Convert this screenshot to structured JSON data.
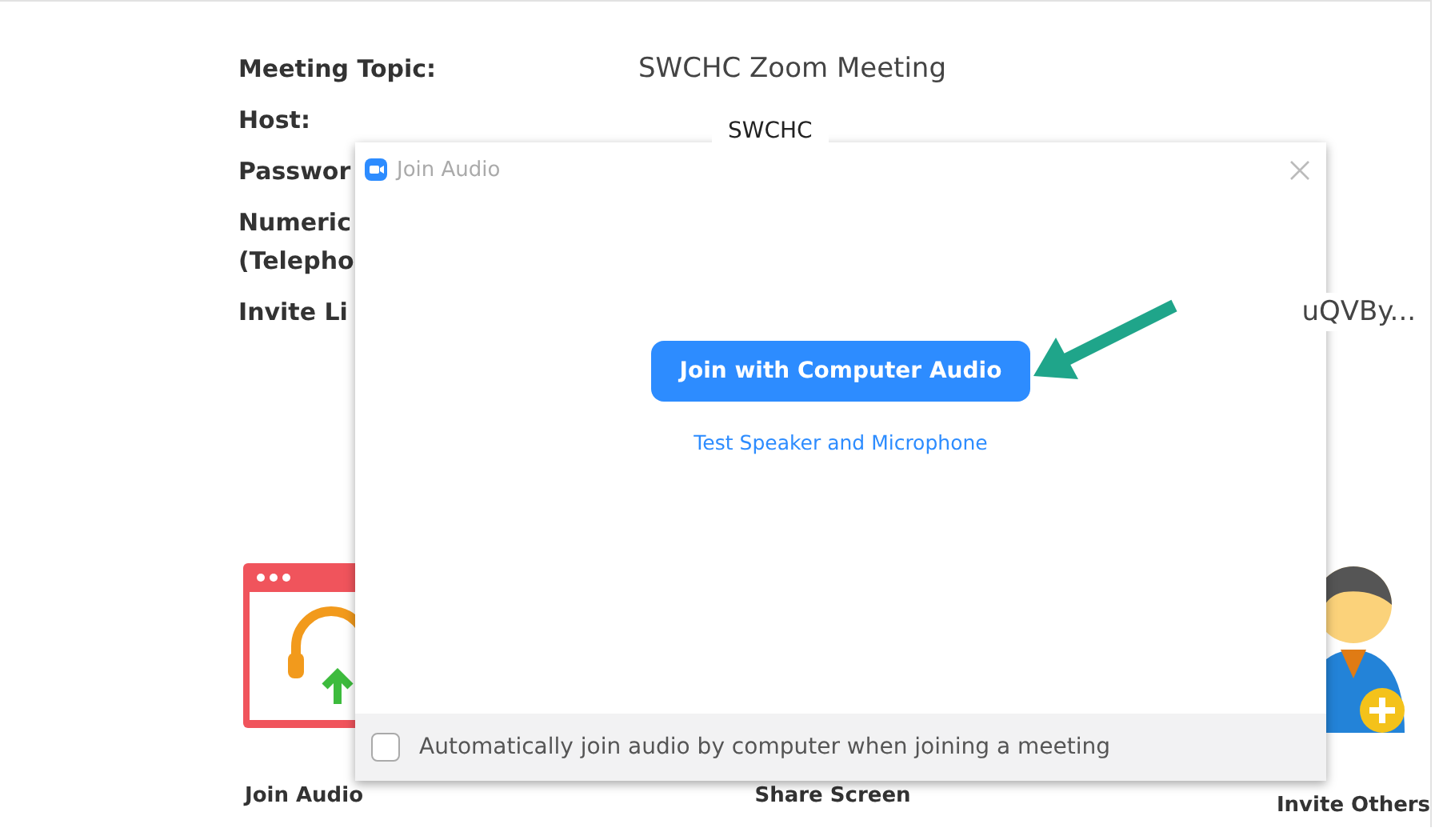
{
  "meeting_info": [
    {
      "kind": "field",
      "label": [
        "Meeting Topic:"
      ],
      "value": "SWCHC Zoom Meeting"
    },
    {
      "label": [
        "Host:"
      ],
      "value": "SWCHC"
    },
    {
      "label": [
        "Passwor"
      ]
    },
    {
      "label": [
        "Numeric",
        "(Telepho"
      ]
    },
    {
      "kind": "link",
      "label": [
        "Invite Li"
      ],
      "value": "uQVBy..."
    }
  ],
  "actions": [
    {
      "kind": "headphones",
      "label": "Join Audio"
    },
    {
      "kind": "share",
      "label": "Share Screen"
    },
    {
      "kind": "invite",
      "label": "Invite Others"
    }
  ],
  "dialog": {
    "title": "Join Audio",
    "primary_button": "Join with Computer Audio",
    "link": "Test Speaker and Microphone",
    "auto_join": {
      "label": "Automatically join audio by computer when joining a meeting",
      "checked": false
    }
  }
}
